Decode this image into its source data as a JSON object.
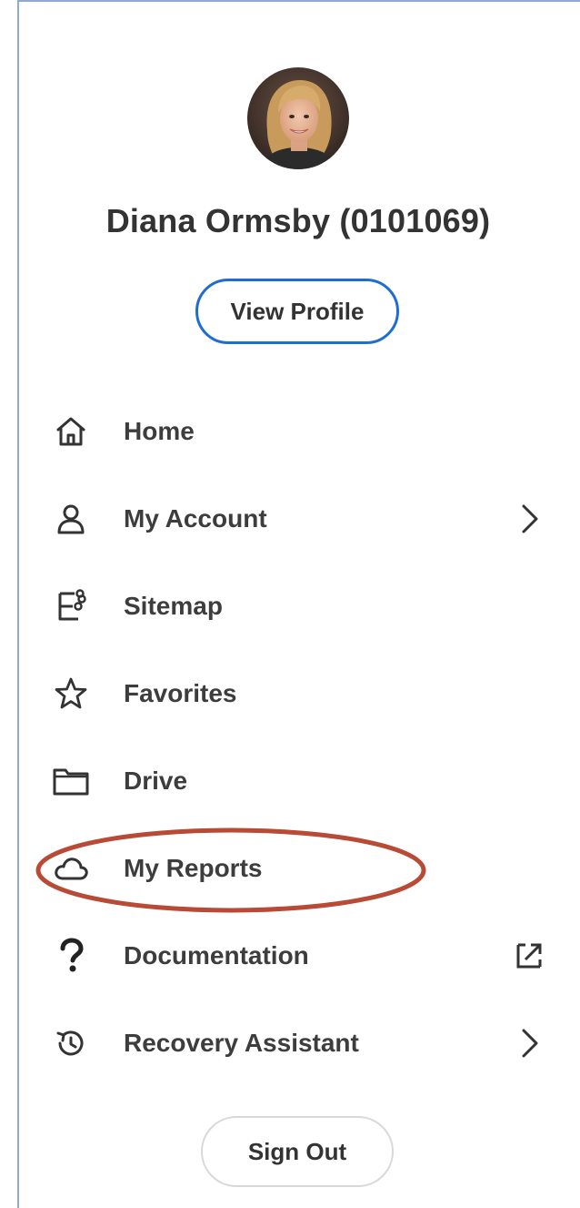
{
  "profile": {
    "name": "Diana Ormsby (0101069)",
    "view_profile_label": "View Profile"
  },
  "menu": {
    "items": [
      {
        "label": "Home",
        "icon": "home-icon"
      },
      {
        "label": "My Account",
        "icon": "user-icon",
        "trailing": "chevron-right-icon"
      },
      {
        "label": "Sitemap",
        "icon": "sitemap-icon"
      },
      {
        "label": "Favorites",
        "icon": "star-icon"
      },
      {
        "label": "Drive",
        "icon": "folder-icon"
      },
      {
        "label": "My Reports",
        "icon": "cloud-icon"
      },
      {
        "label": "Documentation",
        "icon": "question-icon",
        "trailing": "external-link-icon"
      },
      {
        "label": "Recovery Assistant",
        "icon": "history-icon",
        "trailing": "chevron-right-icon"
      }
    ]
  },
  "sign_out_label": "Sign Out",
  "colors": {
    "accent_blue": "#1f6ecf",
    "top_bar": "#0b5cad",
    "annotation_red": "#b84a36",
    "text": "#333333",
    "panel_border": "#8fa9cf"
  }
}
